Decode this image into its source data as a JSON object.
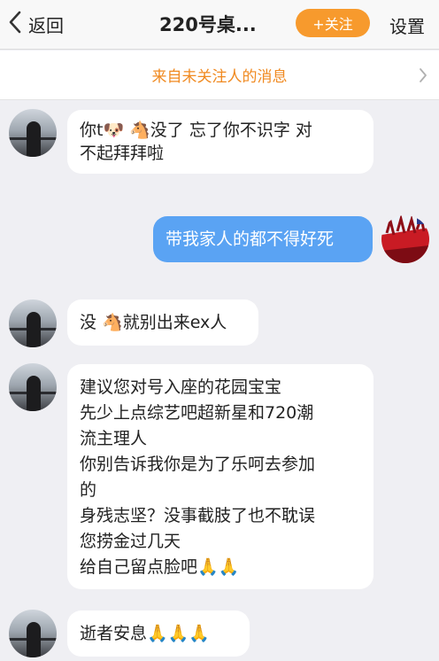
{
  "header": {
    "back_label": "返回",
    "title": "220号桌...",
    "follow_label": "+关注",
    "settings_label": "设置"
  },
  "notice": {
    "text": "来自未关注人的消息"
  },
  "messages": [
    {
      "side": "left",
      "lines": [
        "你t🐶 🐴没了 忘了你不识字 对",
        "不起拜拜啦"
      ]
    },
    {
      "side": "right",
      "lines": [
        "带我家人的都不得好死"
      ]
    },
    {
      "side": "left",
      "lines": [
        "没 🐴就别出来ex人"
      ]
    },
    {
      "side": "left",
      "lines": [
        "建议您对号入座的花园宝宝",
        "先少上点综艺吧超新星和720潮",
        "流主理人",
        "你别告诉我你是为了乐呵去参加",
        "的",
        "身残志坚？没事截肢了也不耽误",
        "您捞金过几天",
        "给自己留点脸吧🙏🙏"
      ]
    },
    {
      "side": "left",
      "lines": [
        "逝者安息🙏🙏🙏"
      ]
    }
  ],
  "colors": {
    "accent": "#f79a2d",
    "notice_text": "#f08a21",
    "sent_bubble": "#5aa3f3",
    "background": "#efeff3"
  },
  "icons": {
    "back": "chevron-left-icon",
    "notice_arrow": "chevron-right-icon"
  }
}
